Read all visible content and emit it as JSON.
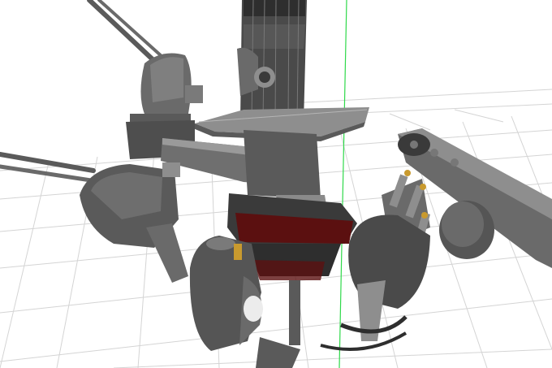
{
  "viewport": {
    "background": "#ffffff",
    "grid_color": "#d4d4d4",
    "axis_color": "#2fd94a",
    "model_colors": {
      "hull_dark": "#4a4a4a",
      "hull_mid": "#6a6a6a",
      "hull_light": "#8e8e8e",
      "highlight": "#b5b5b5",
      "red_band": "#5b1010",
      "brass": "#c99a2e"
    },
    "model_parts": [
      "funnel-tower",
      "upper-deck-platform",
      "rangefinder-arm",
      "secondary-gun-turret-left",
      "barrel-cluster-left",
      "aa-mount-right",
      "searchlight-arm-right",
      "base-drum",
      "lower-left-mount",
      "control-post"
    ]
  }
}
